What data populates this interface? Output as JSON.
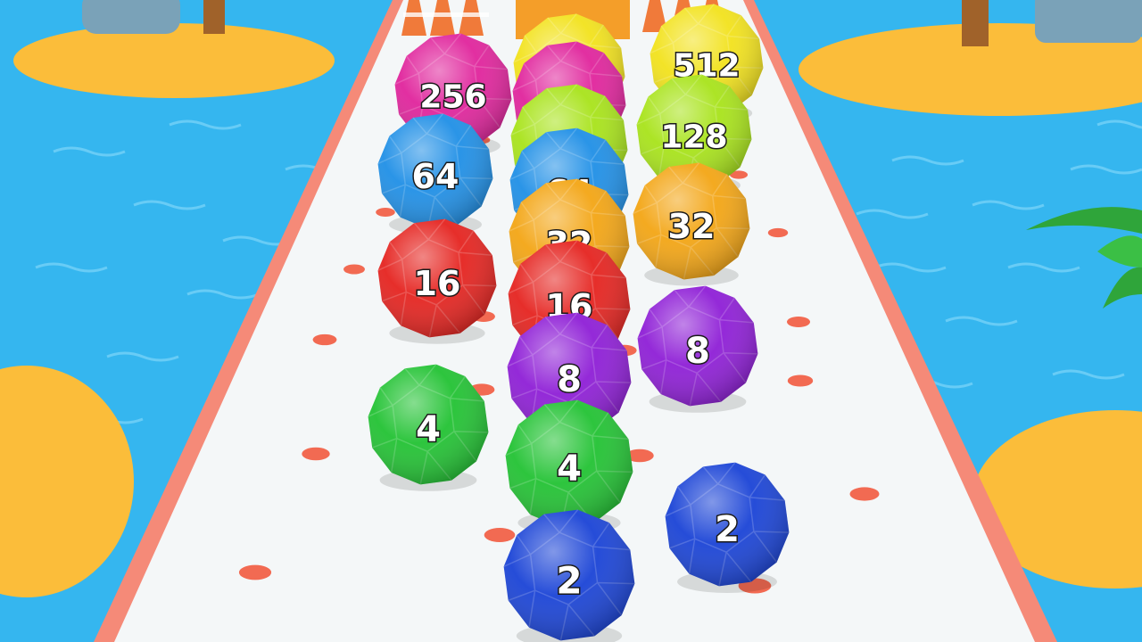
{
  "scene": {
    "colors": {
      "water": "#35b6ef",
      "water_light": "#7fd6fa",
      "sand": "#fbbd3a",
      "track": "#f4f7f8",
      "rail": "#f58a78",
      "dot": "#f26a52"
    }
  },
  "balls": [
    {
      "value": "256",
      "color": "#e0249c"
    },
    {
      "value": "512",
      "color": "#f2e21c"
    },
    {
      "value": "128",
      "color": "#a8e31a"
    },
    {
      "value": "64",
      "color": "#1f8fe6"
    },
    {
      "value": "32",
      "color": "#f3a514"
    },
    {
      "value": "16",
      "color": "#e5231f"
    },
    {
      "value": "8",
      "color": "#8e1ed6"
    },
    {
      "value": "4",
      "color": "#22c233"
    },
    {
      "value": "2",
      "color": "#1a43d6"
    },
    {
      "value": "",
      "color": "#f2e21c"
    },
    {
      "value": "",
      "color": "#e0249c"
    },
    {
      "value": "",
      "color": "#a8e31a"
    },
    {
      "value": "64",
      "color": "#1f8fe6"
    },
    {
      "value": "32",
      "color": "#f3a514"
    },
    {
      "value": "16",
      "color": "#e5231f"
    },
    {
      "value": "8",
      "color": "#8e1ed6"
    },
    {
      "value": "4",
      "color": "#22c233"
    },
    {
      "value": "2",
      "color": "#1a43d6"
    }
  ]
}
